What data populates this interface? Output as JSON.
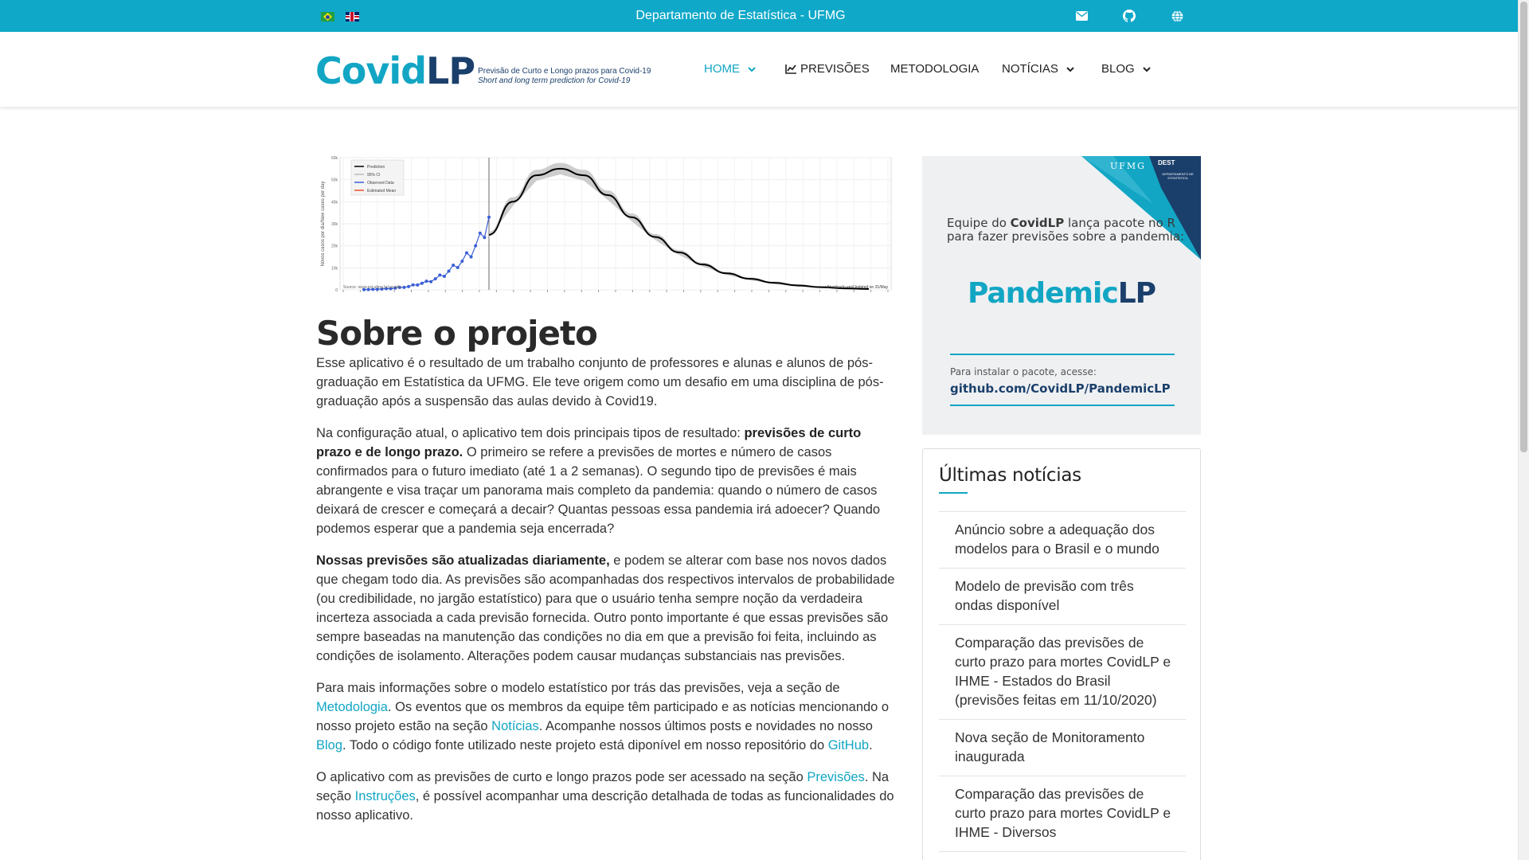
{
  "topbar": {
    "title": "Departamento de Estatística - UFMG",
    "icons": [
      "flag-brazil-icon",
      "flag-uk-icon",
      "mail-icon",
      "github-icon",
      "globe-icon"
    ]
  },
  "colors": {
    "brand": "#12a6c4",
    "brand_dark": "#1b3f6b",
    "topbar": "#0fa8c9"
  },
  "logo": {
    "covid": "Covid",
    "lp": "LP",
    "tagline_pt": "Previsão de Curto e Longo prazos para Covid-19",
    "tagline_en": "Short and long term prediction for Covid-19"
  },
  "nav": {
    "home": "HOME",
    "previsoes": "PREVISÕES",
    "metodologia": "METODOLOGIA",
    "noticias": "NOTÍCIAS",
    "blog": "BLOG"
  },
  "chart_data": {
    "type": "line",
    "ylabel": "Novos casos por dia/New cases per day",
    "yticks": [
      "0",
      "10k",
      "20k",
      "30k",
      "40k",
      "50k",
      "60k"
    ],
    "ylim": [
      0,
      60000
    ],
    "legend": [
      "Prediction",
      "95% CI",
      "Observed Data",
      "Estimated Mean"
    ],
    "source": "Source: www.est.ufmg.br/covidlp",
    "updated": "Atualizado em/Updated on 31/May",
    "peak_value_approx": 55000,
    "series": [
      {
        "name": "Observed Data",
        "values": [
          100,
          150,
          200,
          300,
          350,
          500,
          600,
          800,
          1000,
          1300,
          1500,
          2000,
          2500,
          3000,
          3500,
          4200,
          5000,
          6000,
          7000,
          8500,
          10000,
          11500,
          13000,
          15000,
          17000,
          20000,
          23000,
          27000,
          33000
        ]
      },
      {
        "name": "Prediction",
        "values": [
          25000,
          40000,
          52000,
          55000,
          52000,
          43000,
          33000,
          24000,
          17000,
          11500,
          7500,
          5000,
          3200,
          2000,
          1200,
          700,
          400
        ]
      }
    ]
  },
  "main": {
    "title": "Sobre o projeto",
    "p1": "Esse aplicativo é o resultado de um trabalho conjunto de professores e alunas e alunos de pós-graduação em Estatística da UFMG. Ele teve origem como um desafio em uma disciplina de pós-graduação após a suspensão das aulas devido à Covid19.",
    "p2_pre": "Na configuração atual, o aplicativo tem dois principais tipos de resultado: ",
    "p2_bold": "previsões de curto prazo e de longo prazo.",
    "p2_post": " O primeiro se refere a previsões de mortes e número de casos confirmados para o futuro imediato (até 1 a 2 semanas). O segundo tipo de previsões é mais abrangente e visa traçar um panorama mais completo da pandemia: quando o número de casos deixará de crescer e começará a decair? Quantas pessoas essa pandemia irá adoecer? Quando podemos esperar que a pandemia seja encerrada?",
    "p3_bold": "Nossas previsões são atualizadas diariamente,",
    "p3_post": " e podem se alterar com base nos novos dados que chegam todo dia. As previsões são acompanhadas dos respectivos intervalos de probabilidade (ou credibilidade, no jargão estatístico) para que o usuário tenha sempre noção da verdadeira incerteza associada a cada previsão fornecida. Outro ponto importante é que essas previsões são sempre baseadas na manutenção das condições no dia em que a previsão foi feita, incluindo as condições de isolamento. Alterações podem causar mudanças substanciais nas previsões.",
    "p4_a": "Para mais informações sobre o modelo estatístico por trás das previsões, veja a seção de ",
    "p4_link1": "Metodologia",
    "p4_b": ". Os eventos que os membros da equipe têm participado e as notícias mencionando o nosso projeto estão na seção ",
    "p4_link2": "Notícias",
    "p4_c": ". Acompanhe nossos últimos posts e novidades no nosso ",
    "p4_link3": "Blog",
    "p4_d": ". Todo o código fonte utilizado neste projeto está diponível em nosso repositório do ",
    "p4_link4": "GitHub",
    "p4_e": ".",
    "p5_a": "O aplicativo com as previsões de curto e longo prazos pode ser acessado na seção ",
    "p5_link1": "Previsões",
    "p5_b": ". Na seção ",
    "p5_link2": "Instruções",
    "p5_c": ", é possível acompanhar uma descrição detalhada de todas as funcionalidades do nosso aplicativo."
  },
  "banner": {
    "ufmg": "UFMG",
    "dest": "DEST",
    "dest_sub": "DEPARTAMENTO DE ESTATÍSTICA",
    "text_a": "Equipe do ",
    "text_bold": "CovidLP",
    "text_b": " lança pacote no R para fazer previsões sobre a pandemia:",
    "brand_a": "Pandemic",
    "brand_b": "LP",
    "install": "Para instalar o pacote, acesse:",
    "url": "github.com/CovidLP/PandemicLP"
  },
  "news": {
    "title": "Últimas notícias",
    "items": [
      "Anúncio sobre a adequação dos modelos para o Brasil e o mundo",
      "Modelo de previsão com três ondas disponível",
      "Comparação das previsões de curto prazo para mortes CovidLP e IHME - Estados do Brasil (previsões feitas em 11/10/2020)",
      "Nova seção de Monitoramento inaugurada",
      "Comparação das previsões de curto prazo para mortes CovidLP e IHME - Diversos"
    ]
  }
}
